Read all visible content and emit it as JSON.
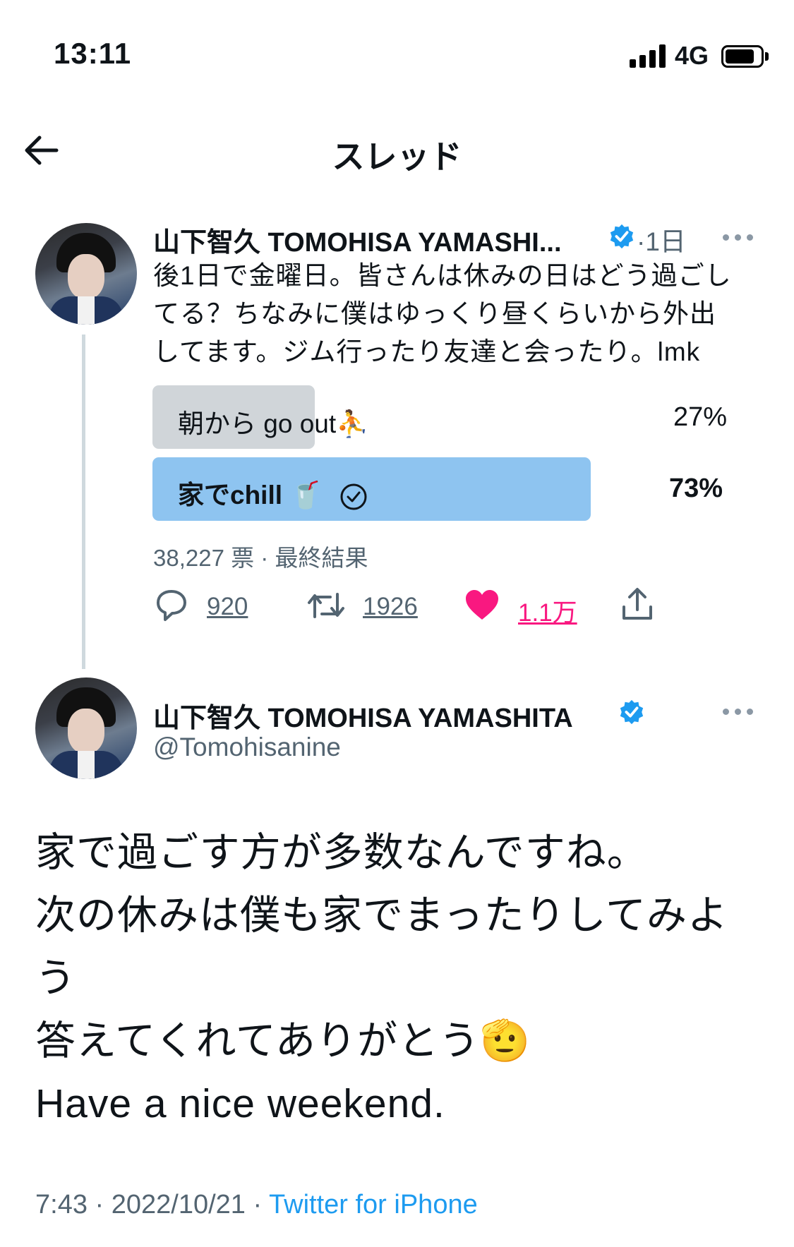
{
  "status_bar": {
    "time": "13:11",
    "network": "4G"
  },
  "header": {
    "title": "スレッド"
  },
  "tweet1": {
    "name": "山下智久 TOMOHISA YAMASHI...",
    "time_sep": "·",
    "time": "1日",
    "text_lines": [
      "後1日で金曜日。皆さんは休みの日はどう過ごし",
      "てる？ちなみに僕はゆっくり昼くらいから外出",
      "してます。ジム行ったり友達と会ったり。lmk"
    ],
    "poll": {
      "options": [
        {
          "label": "朝から go out",
          "emoji": "⛹",
          "percent": "27%",
          "share": 0.27
        },
        {
          "label": "家でchill",
          "emoji": "🥤",
          "percent": "73%",
          "share": 0.73,
          "selected": true
        }
      ],
      "votes": "38,227 票",
      "sep": "·",
      "status": "最終結果"
    },
    "actions": {
      "replies": "920",
      "retweets": "1926",
      "likes": "1.1万"
    }
  },
  "tweet2": {
    "name": "山下智久 TOMOHISA YAMASHITA",
    "handle": "@Tomohisanine",
    "body_lines": [
      "家で過ごす方が多数なんですね。",
      "次の休みは僕も家でまったりしてみよ",
      "う",
      "答えてくれてありがとう🫡",
      "Have a nice weekend."
    ],
    "timestamp": "7:43",
    "date": "2022/10/21",
    "sep": "·",
    "source": "Twitter for iPhone"
  },
  "colors": {
    "accent": "#1d9bf0",
    "like": "#f91880",
    "poll_winner": "#8ec4f0",
    "poll_other": "#d0d5d9",
    "secondary_text": "#536471"
  },
  "icons": [
    "back-arrow-icon",
    "verified-badge-icon",
    "more-icon",
    "reply-icon",
    "retweet-icon",
    "heart-icon",
    "share-icon",
    "check-circle-icon"
  ]
}
